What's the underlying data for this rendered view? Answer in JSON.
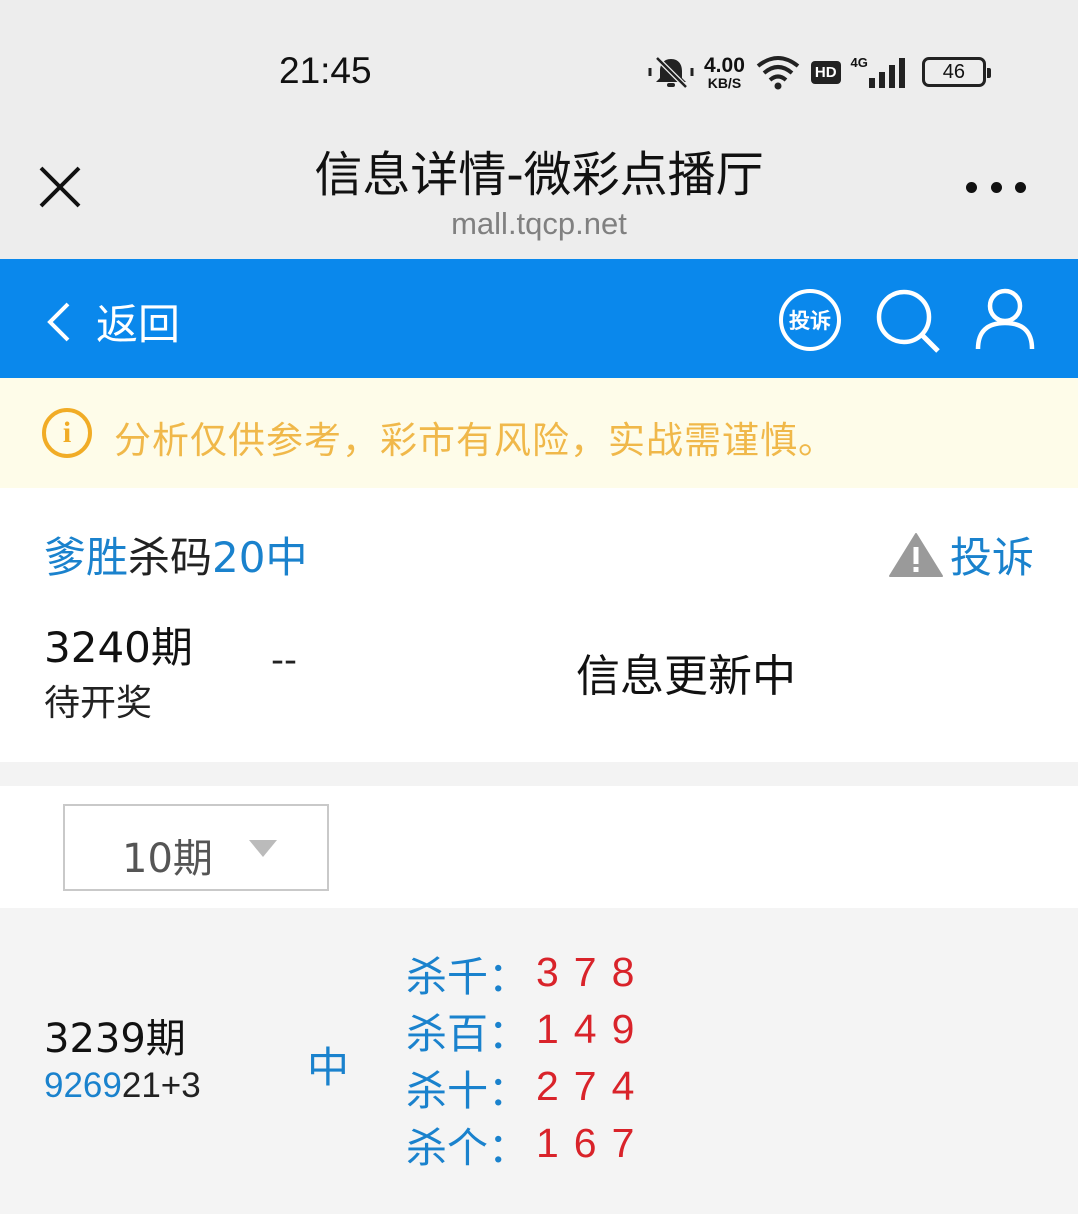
{
  "status_bar": {
    "time": "21:45",
    "speed_value": "4.00",
    "speed_unit": "KB/S",
    "hd_label": "HD",
    "network_label": "4G",
    "battery_level": "46"
  },
  "title_bar": {
    "title": "信息详情-微彩点播厅",
    "url": "mall.tqcp.net"
  },
  "nav": {
    "back_label": "返回",
    "complain_label": "投诉"
  },
  "warning": {
    "icon_char": "i",
    "text": "分析仅供参考，彩市有风险，实战需谨慎。"
  },
  "header": {
    "author": "爹胜",
    "type": "杀码",
    "record": "20中",
    "complain_label": "投诉"
  },
  "current_issue": {
    "issue": "3240期",
    "status": "待开奖",
    "result": "--",
    "info": "信息更新中"
  },
  "period_select": {
    "value": "10期"
  },
  "past_issue": {
    "issue": "3239期",
    "draw_highlight": "9269",
    "draw_rest": "21+3",
    "hit": "中",
    "kills": [
      {
        "label": "杀千：",
        "numbers": "378"
      },
      {
        "label": "杀百：",
        "numbers": "149"
      },
      {
        "label": "杀十：",
        "numbers": "274"
      },
      {
        "label": "杀个：",
        "numbers": "167"
      }
    ]
  },
  "colors": {
    "nav_blue": "#0a88ec",
    "link_blue": "#1a82cd",
    "warning_text": "#f0b84a",
    "kill_red": "#d9232a"
  }
}
